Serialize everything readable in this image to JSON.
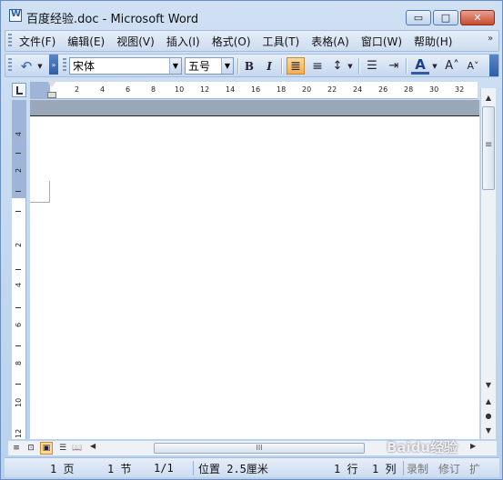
{
  "window": {
    "title": "百度经验.doc - Microsoft Word",
    "minimize_glyph": "▭",
    "maximize_glyph": "□",
    "close_glyph": "✕"
  },
  "menu": {
    "items": [
      "文件(F)",
      "编辑(E)",
      "视图(V)",
      "插入(I)",
      "格式(O)",
      "工具(T)",
      "表格(A)",
      "窗口(W)",
      "帮助(H)"
    ],
    "overflow": "»"
  },
  "toolbar": {
    "undo_glyph": "↶",
    "font_name": "宋体",
    "font_size": "五号",
    "bold": "B",
    "italic": "I",
    "align_justify_glyph": "≣",
    "align_center_glyph": "≡",
    "line_spacing_glyph": "↕",
    "list_glyph": "☰",
    "indent_glyph": "⇥",
    "font_color": "A",
    "grow_font": "A˄",
    "shrink_font": "A˅",
    "accent_color": "#2e5ea8"
  },
  "ruler": {
    "ticks": [
      "2",
      "4",
      "6",
      "8",
      "10",
      "12",
      "14",
      "16",
      "18",
      "20",
      "22",
      "24",
      "26",
      "28",
      "30",
      "32"
    ],
    "vticks": [
      "4",
      "2",
      "2",
      "4",
      "6",
      "8",
      "10",
      "12"
    ]
  },
  "scroll": {
    "up": "▲",
    "down": "▼",
    "prev_page": "▲",
    "select_browse": "●",
    "next_page": "▼",
    "left": "◀",
    "right": "▶",
    "thumb_grip": "III"
  },
  "views": {
    "normal": "≡",
    "web": "⊡",
    "print": "▣",
    "outline": "☰",
    "reading": "📖"
  },
  "status": {
    "page": "1 页",
    "section": "1 节",
    "page_of": "1/1",
    "position": "位置 2.5厘米",
    "line": "1 行",
    "column": "1 列",
    "record": "录制",
    "revision": "修订",
    "extend": "扩"
  },
  "watermark": "Baidu经验"
}
